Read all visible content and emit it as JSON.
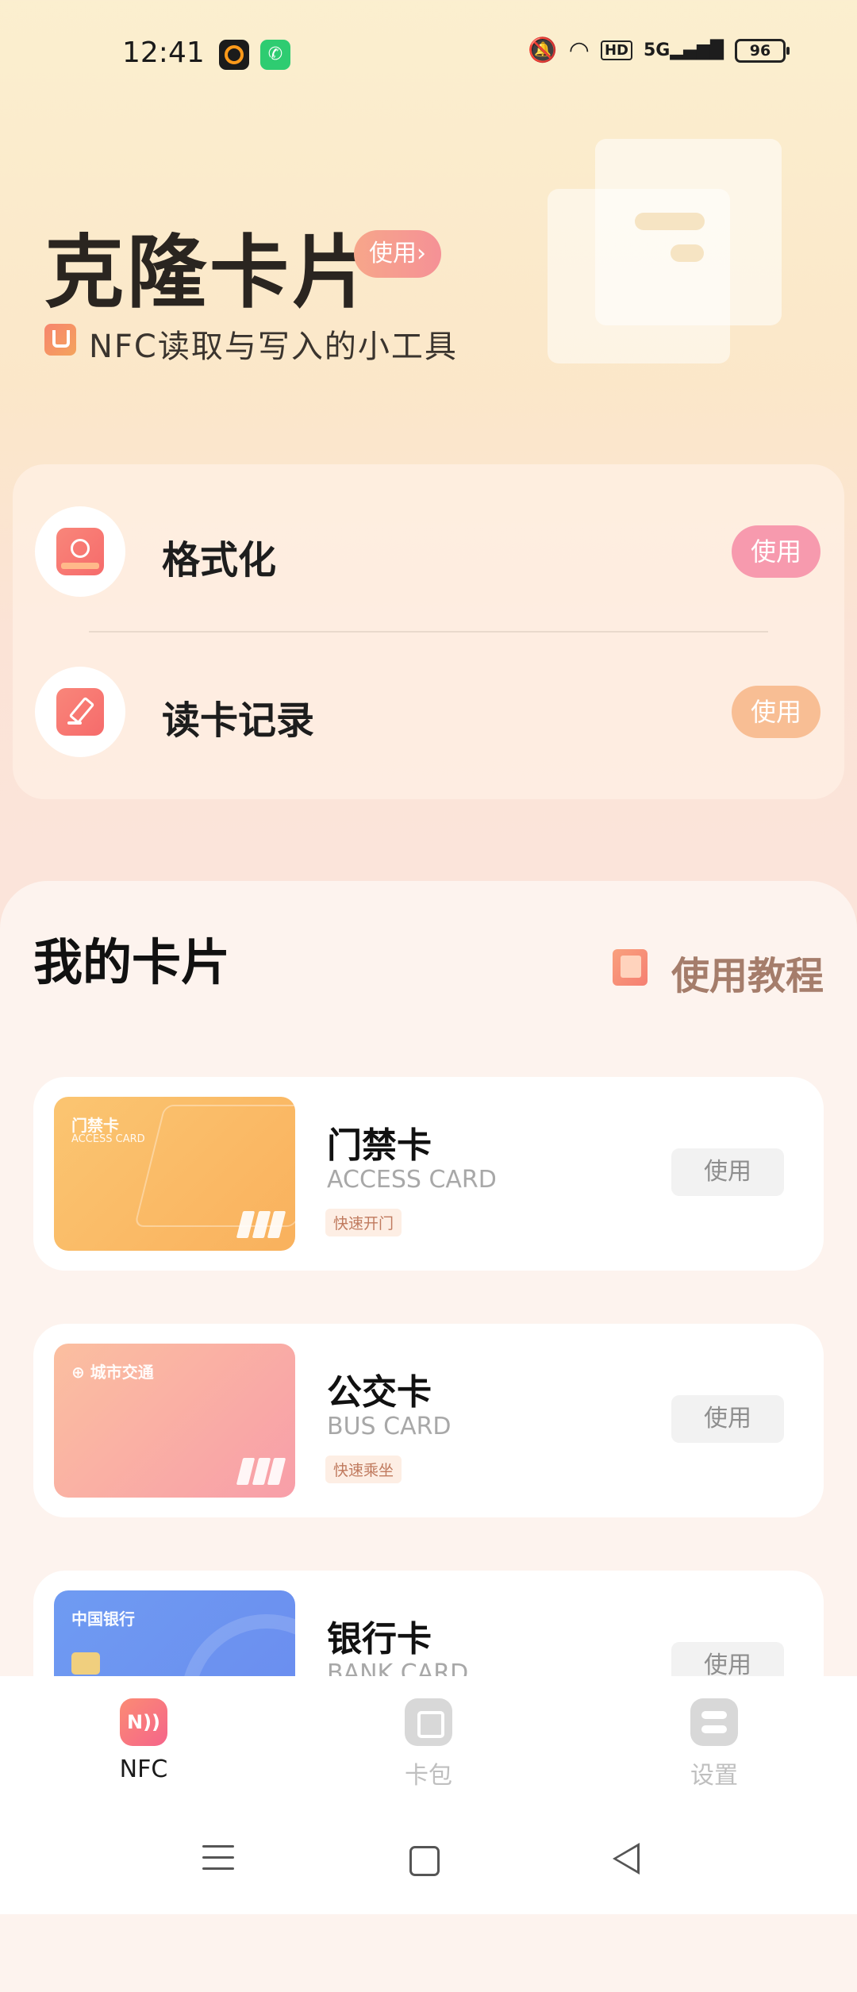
{
  "status_bar": {
    "time": "12:41",
    "battery": "96",
    "icons": [
      "mute-icon",
      "wifi-icon",
      "hd-icon",
      "5g-signal-icon",
      "battery-icon"
    ]
  },
  "header": {
    "title": "克隆卡片",
    "title_pill": "使用›",
    "subtitle": "NFC读取与写入的小工具"
  },
  "tools": [
    {
      "label": "格式化",
      "button": "使用",
      "icon": "format-icon"
    },
    {
      "label": "读卡记录",
      "button": "使用",
      "icon": "read-record-icon"
    }
  ],
  "my_cards": {
    "title": "我的卡片",
    "tutorial_label": "使用教程",
    "items": [
      {
        "name": "门禁卡",
        "en": "ACCESS CARD",
        "tag": "快速开门",
        "button": "使用",
        "thumb_title": "门禁卡",
        "thumb_sub": "ACCESS CARD"
      },
      {
        "name": "公交卡",
        "en": "BUS CARD",
        "tag": "快速乘坐",
        "button": "使用",
        "thumb_title": "⊕ 城市交通",
        "thumb_sub": ""
      },
      {
        "name": "银行卡",
        "en": "BANK CARD",
        "tag": "",
        "button": "使用",
        "thumb_title": "中国银行",
        "thumb_sub": ""
      }
    ]
  },
  "bottom_nav": {
    "items": [
      {
        "label": "NFC",
        "icon_text": "N))"
      },
      {
        "label": "卡包"
      },
      {
        "label": "设置"
      }
    ]
  },
  "colors": {
    "accent_pink": "#f79aae",
    "accent_orange": "#f8be94",
    "text_dark": "#1d1d1d"
  }
}
